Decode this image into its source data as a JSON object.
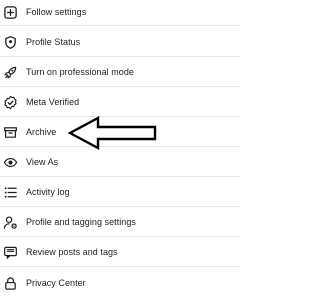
{
  "menu": {
    "items": [
      {
        "label": "Follow settings",
        "icon": "plus-square-icon"
      },
      {
        "label": "Profile Status",
        "icon": "shield-icon"
      },
      {
        "label": "Turn on professional mode",
        "icon": "rocket-icon"
      },
      {
        "label": "Meta Verified",
        "icon": "verified-badge-icon"
      },
      {
        "label": "Archive",
        "icon": "archive-box-icon"
      },
      {
        "label": "View As",
        "icon": "eye-icon"
      },
      {
        "label": "Activity log",
        "icon": "list-icon"
      },
      {
        "label": "Profile and tagging settings",
        "icon": "person-gear-icon"
      },
      {
        "label": "Review posts and tags",
        "icon": "review-chat-icon"
      },
      {
        "label": "Privacy Center",
        "icon": "lock-icon"
      }
    ]
  },
  "annotation": {
    "arrow": "left-pointing-arrow-icon",
    "color": "#000000"
  }
}
